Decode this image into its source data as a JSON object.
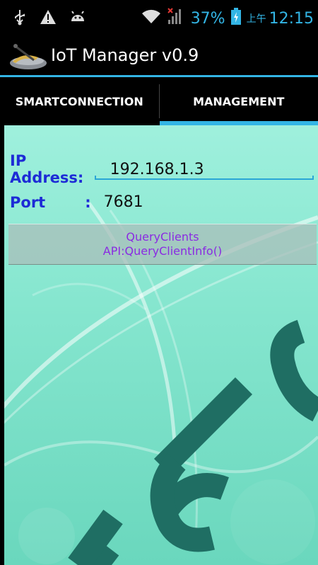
{
  "status_bar": {
    "battery_percent": "37%",
    "time_prefix": "上午",
    "time": "12:15",
    "icons": [
      "usb-icon",
      "warning-icon",
      "android-icon",
      "wifi-icon",
      "signal-icon",
      "battery-icon"
    ]
  },
  "action_bar": {
    "title": "IoT Manager v0.9"
  },
  "tabs": [
    {
      "label": "SMARTCONNECTION",
      "selected": false
    },
    {
      "label": "MANAGEMENT",
      "selected": true
    }
  ],
  "form": {
    "ip_label": "IP Address:",
    "ip_value": "192.168.1.3",
    "port_label": "Port",
    "port_colon": ":",
    "port_value": "7681"
  },
  "query_button": {
    "line1": "QueryClients",
    "line2": "API:QueryClientInfo()"
  },
  "colors": {
    "accent": "#33b5e5",
    "label": "#1d2bd6",
    "button_text": "#8a2be2",
    "watermark": "#1f6e63"
  }
}
